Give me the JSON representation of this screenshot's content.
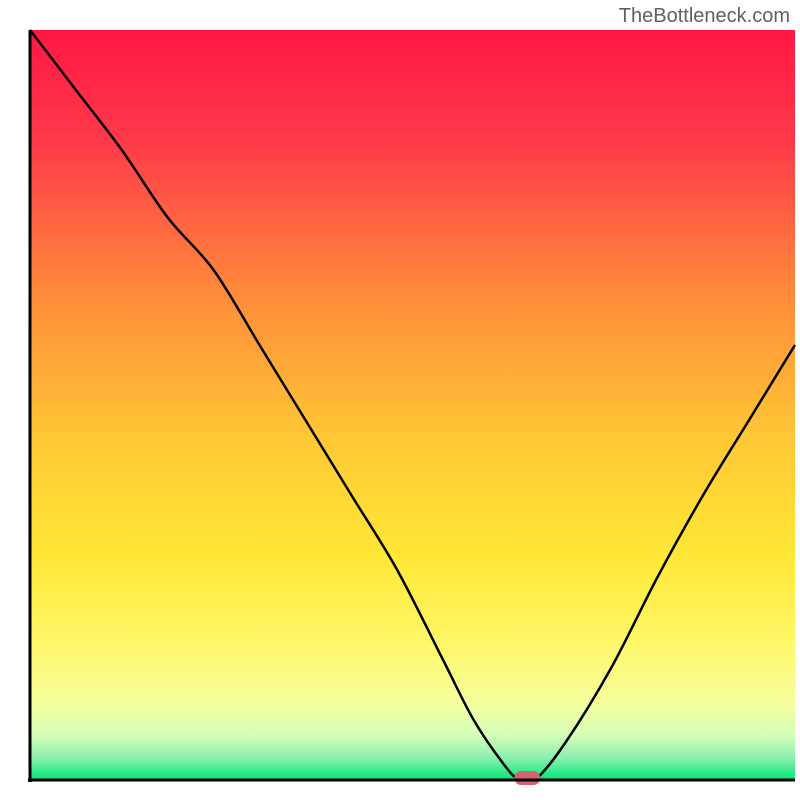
{
  "watermark": "TheBottleneck.com",
  "chart_data": {
    "type": "line",
    "title": "",
    "xlabel": "",
    "ylabel": "",
    "xlim": [
      0,
      100
    ],
    "ylim": [
      0,
      100
    ],
    "x": [
      0,
      6,
      12,
      18,
      24,
      30,
      36,
      42,
      48,
      54,
      58,
      62,
      64,
      66,
      70,
      76,
      82,
      88,
      94,
      100
    ],
    "values": [
      100,
      92,
      84,
      75,
      68,
      58,
      48,
      38,
      28,
      16,
      8,
      2,
      0,
      0,
      5,
      15,
      27,
      38,
      48,
      58
    ],
    "marker": {
      "x": 65,
      "y": 0,
      "color": "#d4636f"
    },
    "background": {
      "type": "vertical_gradient",
      "stops": [
        {
          "offset": 0,
          "color": "#ff1744"
        },
        {
          "offset": 0.15,
          "color": "#ff3a4a"
        },
        {
          "offset": 0.35,
          "color": "#ff8a3a"
        },
        {
          "offset": 0.55,
          "color": "#ffc935"
        },
        {
          "offset": 0.7,
          "color": "#ffe735"
        },
        {
          "offset": 0.82,
          "color": "#fff86a"
        },
        {
          "offset": 0.9,
          "color": "#f5ffa0"
        },
        {
          "offset": 0.94,
          "color": "#d5ffb8"
        },
        {
          "offset": 0.97,
          "color": "#8cf0b0"
        },
        {
          "offset": 1.0,
          "color": "#00e878"
        }
      ]
    },
    "axes_color": "#000000",
    "line_color": "#000000"
  }
}
